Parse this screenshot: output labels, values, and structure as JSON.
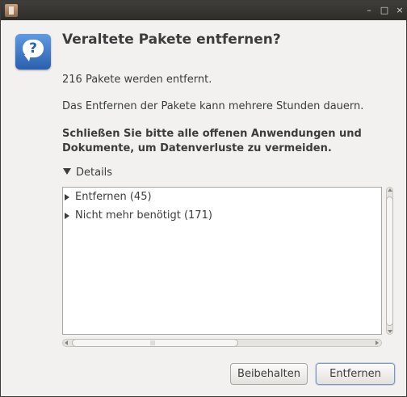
{
  "window": {
    "minimize": "–",
    "maximize": "□",
    "close": "×"
  },
  "icon": "question-icon",
  "icon_glyph": "?",
  "title": "Veraltete Pakete entfernen?",
  "message1": "216 Pakete werden entfernt.",
  "message2": "Das Entfernen der Pakete kann mehrere Stunden dauern.",
  "warning_line1": "Schließen Sie bitte alle offenen Anwendungen und",
  "warning_line2": "Dokumente, um Datenverluste zu vermeiden.",
  "details": {
    "label": "Details",
    "expanded": true
  },
  "tree": [
    {
      "label": "Entfernen (45)"
    },
    {
      "label": "Nicht mehr benötigt (171)"
    }
  ],
  "buttons": {
    "keep": "Beibehalten",
    "remove": "Entfernen"
  }
}
